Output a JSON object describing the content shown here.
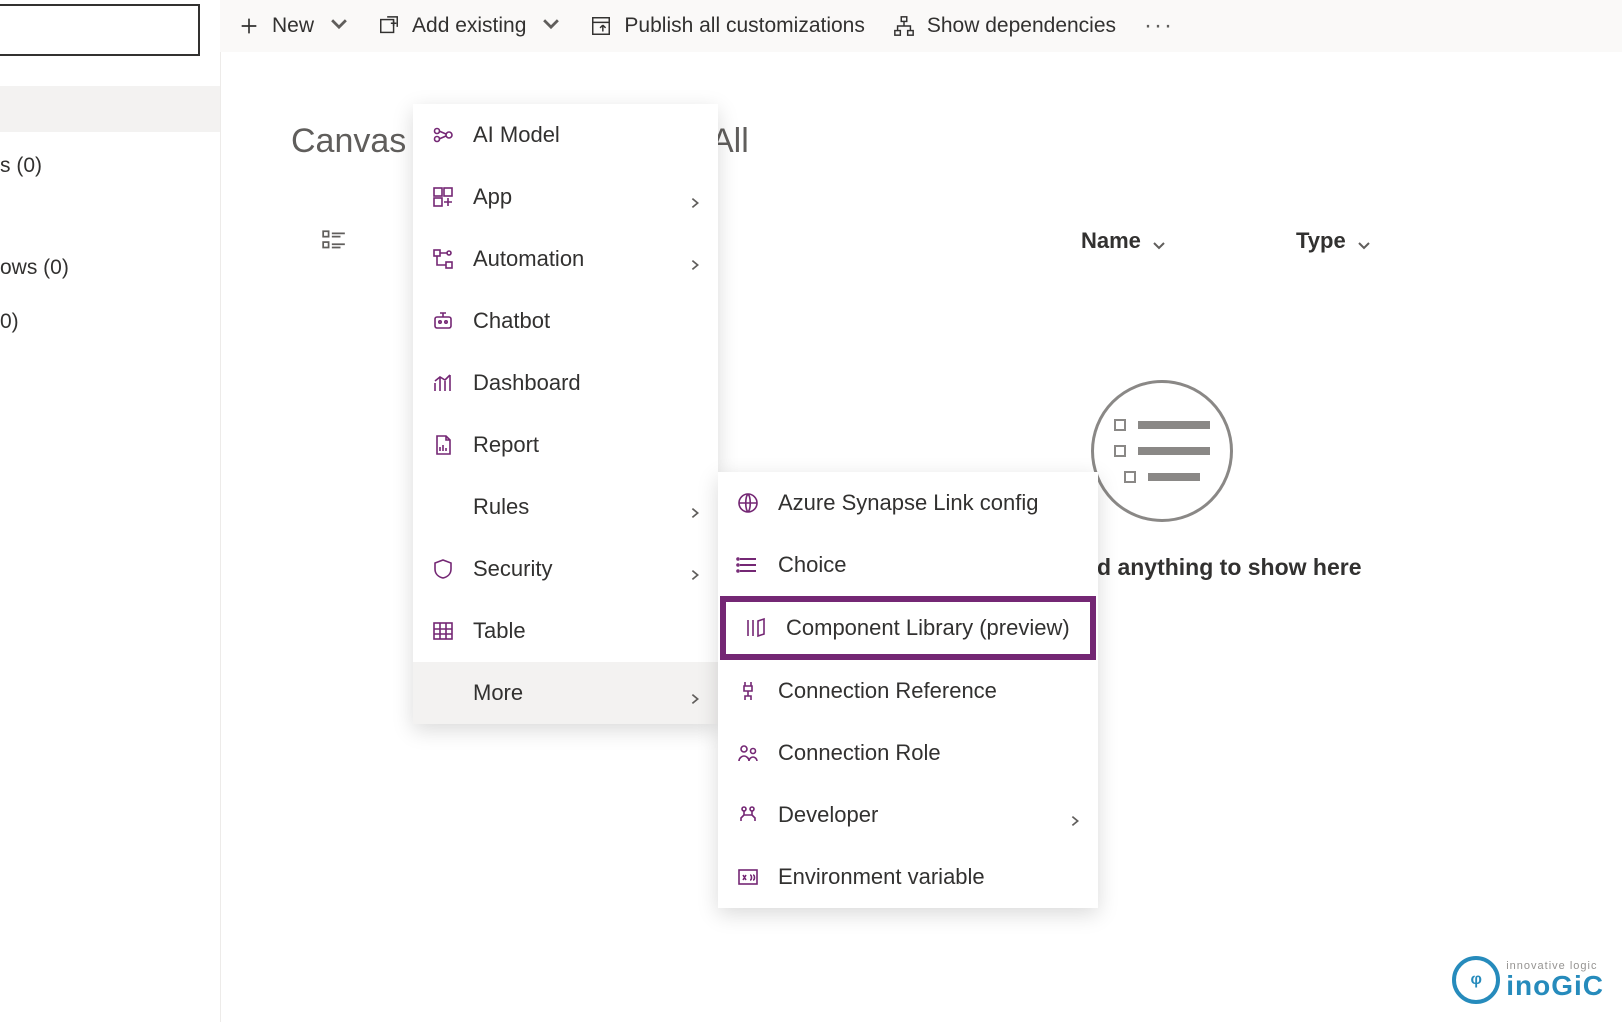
{
  "commands": {
    "new": "New",
    "add_existing": "Add existing",
    "publish": "Publish all customizations",
    "dependencies": "Show dependencies"
  },
  "sidebar": {
    "item1": "s  (0)",
    "item2": "ows  (0)",
    "item3": "0)"
  },
  "page": {
    "title_prefix": "Canvas C",
    "title_suffix": "All"
  },
  "columns": {
    "name": "Name",
    "type": "Type"
  },
  "empty": {
    "text": "d anything to show here"
  },
  "menu1": {
    "ai": "AI Model",
    "app": "App",
    "automation": "Automation",
    "chatbot": "Chatbot",
    "dashboard": "Dashboard",
    "report": "Report",
    "rules": "Rules",
    "security": "Security",
    "table": "Table",
    "more": "More"
  },
  "menu2": {
    "synapse": "Azure Synapse Link config",
    "choice": "Choice",
    "complib": "Component Library (preview)",
    "connref": "Connection Reference",
    "connrole": "Connection Role",
    "dev": "Developer",
    "envvar": "Environment variable"
  },
  "watermark": {
    "tag": "innovative logic",
    "name": "inoGiC"
  }
}
